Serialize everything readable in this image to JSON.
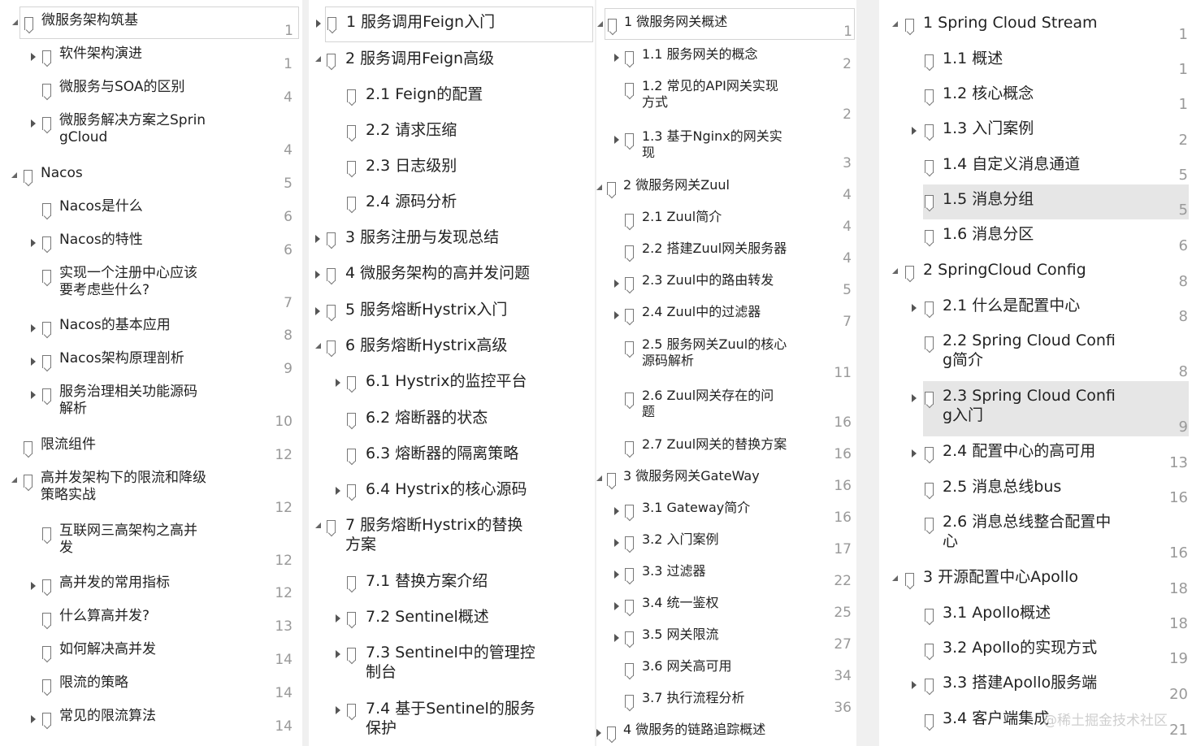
{
  "columns": [
    {
      "id": "col-0",
      "items": [
        {
          "label": "微服务架构筑基",
          "page": "1",
          "level": 0,
          "expander": "expanded",
          "boxed": true
        },
        {
          "label": "软件架构演进",
          "page": "1",
          "level": 1,
          "expander": "collapsed"
        },
        {
          "label": "微服务与SOA的区别",
          "page": "4",
          "level": 1,
          "expander": "none"
        },
        {
          "label": "微服务解决方案之Sprin\ngCloud",
          "page": "4",
          "level": 1,
          "expander": "collapsed"
        },
        {
          "label": "Nacos",
          "page": "5",
          "level": 0,
          "expander": "expanded"
        },
        {
          "label": "Nacos是什么",
          "page": "6",
          "level": 1,
          "expander": "none"
        },
        {
          "label": "Nacos的特性",
          "page": "6",
          "level": 1,
          "expander": "collapsed"
        },
        {
          "label": "实现一个注册中心应该\n要考虑些什么?",
          "page": "7",
          "level": 1,
          "expander": "none"
        },
        {
          "label": "Nacos的基本应用",
          "page": "8",
          "level": 1,
          "expander": "collapsed"
        },
        {
          "label": "Nacos架构原理剖析",
          "page": "9",
          "level": 1,
          "expander": "collapsed"
        },
        {
          "label": "服务治理相关功能源码\n解析",
          "page": "10",
          "level": 1,
          "expander": "collapsed"
        },
        {
          "label": "限流组件",
          "page": "12",
          "level": 0,
          "expander": "none"
        },
        {
          "label": "高并发架构下的限流和降级\n策略实战",
          "page": "12",
          "level": 0,
          "expander": "expanded"
        },
        {
          "label": "互联网三高架构之高并\n发",
          "page": "12",
          "level": 1,
          "expander": "none"
        },
        {
          "label": "高并发的常用指标",
          "page": "12",
          "level": 1,
          "expander": "collapsed"
        },
        {
          "label": "什么算高并发?",
          "page": "13",
          "level": 1,
          "expander": "none"
        },
        {
          "label": "如何解决高并发",
          "page": "14",
          "level": 1,
          "expander": "none"
        },
        {
          "label": "限流的策略",
          "page": "14",
          "level": 1,
          "expander": "none"
        },
        {
          "label": "常见的限流算法",
          "page": "14",
          "level": 1,
          "expander": "collapsed"
        }
      ]
    },
    {
      "id": "col-1",
      "items": [
        {
          "label": "1 服务调用Feign入门",
          "page": "",
          "level": 0,
          "expander": "collapsed",
          "boxed": true
        },
        {
          "label": "2 服务调用Feign高级",
          "page": "",
          "level": 0,
          "expander": "expanded"
        },
        {
          "label": "2.1 Feign的配置",
          "page": "",
          "level": 1,
          "expander": "none"
        },
        {
          "label": "2.2 请求压缩",
          "page": "",
          "level": 1,
          "expander": "none"
        },
        {
          "label": "2.3 日志级别",
          "page": "",
          "level": 1,
          "expander": "none"
        },
        {
          "label": "2.4 源码分析",
          "page": "",
          "level": 1,
          "expander": "none"
        },
        {
          "label": "3 服务注册与发现总结",
          "page": "",
          "level": 0,
          "expander": "collapsed"
        },
        {
          "label": "4 微服务架构的高并发问题",
          "page": "",
          "level": 0,
          "expander": "collapsed"
        },
        {
          "label": "5 服务熔断Hystrix入门",
          "page": "",
          "level": 0,
          "expander": "collapsed"
        },
        {
          "label": "6 服务熔断Hystrix高级",
          "page": "",
          "level": 0,
          "expander": "expanded"
        },
        {
          "label": "6.1 Hystrix的监控平台",
          "page": "",
          "level": 1,
          "expander": "collapsed"
        },
        {
          "label": "6.2 熔断器的状态",
          "page": "",
          "level": 1,
          "expander": "none"
        },
        {
          "label": "6.3 熔断器的隔离策略",
          "page": "",
          "level": 1,
          "expander": "none"
        },
        {
          "label": "6.4 Hystrix的核心源码",
          "page": "",
          "level": 1,
          "expander": "collapsed"
        },
        {
          "label": "7 服务熔断Hystrix的替换\n方案",
          "page": "",
          "level": 0,
          "expander": "expanded"
        },
        {
          "label": "7.1 替换方案介绍",
          "page": "",
          "level": 1,
          "expander": "none"
        },
        {
          "label": "7.2 Sentinel概述",
          "page": "",
          "level": 1,
          "expander": "collapsed"
        },
        {
          "label": "7.3 Sentinel中的管理控\n制台",
          "page": "",
          "level": 1,
          "expander": "collapsed"
        },
        {
          "label": "7.4 基于Sentinel的服务\n保护",
          "page": "",
          "level": 1,
          "expander": "collapsed"
        }
      ]
    },
    {
      "id": "col-2",
      "items": [
        {
          "label": "1 微服务网关概述",
          "page": "1",
          "level": 0,
          "expander": "expanded",
          "boxed": true
        },
        {
          "label": "1.1 服务网关的概念",
          "page": "2",
          "level": 1,
          "expander": "collapsed"
        },
        {
          "label": "1.2 常见的API网关实现\n方式",
          "page": "2",
          "level": 1,
          "expander": "none"
        },
        {
          "label": "1.3 基于Nginx的网关实\n现",
          "page": "3",
          "level": 1,
          "expander": "collapsed"
        },
        {
          "label": "2 微服务网关Zuul",
          "page": "4",
          "level": 0,
          "expander": "expanded"
        },
        {
          "label": "2.1 Zuul简介",
          "page": "4",
          "level": 1,
          "expander": "none"
        },
        {
          "label": "2.2 搭建Zuul网关服务器",
          "page": "4",
          "level": 1,
          "expander": "none"
        },
        {
          "label": "2.3 Zuul中的路由转发",
          "page": "5",
          "level": 1,
          "expander": "collapsed"
        },
        {
          "label": "2.4 Zuul中的过滤器",
          "page": "7",
          "level": 1,
          "expander": "collapsed"
        },
        {
          "label": "2.5 服务网关Zuul的核心\n源码解析",
          "page": "11",
          "level": 1,
          "expander": "none"
        },
        {
          "label": "2.6  Zuul网关存在的问\n题",
          "page": "16",
          "level": 1,
          "expander": "none"
        },
        {
          "label": "2.7 Zuul网关的替换方案",
          "page": "16",
          "level": 1,
          "expander": "none"
        },
        {
          "label": "3 微服务网关GateWay",
          "page": "16",
          "level": 0,
          "expander": "expanded"
        },
        {
          "label": "3.1 Gateway简介",
          "page": "16",
          "level": 1,
          "expander": "collapsed"
        },
        {
          "label": "3.2 入门案例",
          "page": "17",
          "level": 1,
          "expander": "collapsed"
        },
        {
          "label": "3.3 过滤器",
          "page": "22",
          "level": 1,
          "expander": "collapsed"
        },
        {
          "label": "3.4 统一鉴权",
          "page": "25",
          "level": 1,
          "expander": "collapsed"
        },
        {
          "label": "3.5 网关限流",
          "page": "27",
          "level": 1,
          "expander": "collapsed"
        },
        {
          "label": "3.6 网关高可用",
          "page": "34",
          "level": 1,
          "expander": "none"
        },
        {
          "label": "3.7 执行流程分析",
          "page": "36",
          "level": 1,
          "expander": "none"
        },
        {
          "label": "4 微服务的链路追踪概述",
          "page": "",
          "level": 0,
          "expander": "collapsed"
        }
      ]
    },
    {
      "id": "col-3",
      "items": [
        {
          "label": "1 Spring Cloud Stream",
          "page": "1",
          "level": 0,
          "expander": "expanded"
        },
        {
          "label": "1.1 概述",
          "page": "1",
          "level": 1,
          "expander": "none"
        },
        {
          "label": "1.2 核心概念",
          "page": "1",
          "level": 1,
          "expander": "none"
        },
        {
          "label": "1.3 入门案例",
          "page": "2",
          "level": 1,
          "expander": "collapsed"
        },
        {
          "label": "1.4 自定义消息通道",
          "page": "5",
          "level": 1,
          "expander": "none"
        },
        {
          "label": "1.5 消息分组",
          "page": "5",
          "level": 1,
          "expander": "none",
          "highlighted": true
        },
        {
          "label": "1.6 消息分区",
          "page": "6",
          "level": 1,
          "expander": "none"
        },
        {
          "label": "2 SpringCloud Config",
          "page": "8",
          "level": 0,
          "expander": "expanded"
        },
        {
          "label": "2.1 什么是配置中心",
          "page": "8",
          "level": 1,
          "expander": "collapsed"
        },
        {
          "label": "2.2 Spring Cloud Confi\ng简介",
          "page": "8",
          "level": 1,
          "expander": "none"
        },
        {
          "label": "2.3 Spring Cloud Confi\ng入门",
          "page": "9",
          "level": 1,
          "expander": "collapsed",
          "highlighted": true
        },
        {
          "label": "2.4 配置中心的高可用",
          "page": "13",
          "level": 1,
          "expander": "collapsed"
        },
        {
          "label": "2.5 消息总线bus",
          "page": "16",
          "level": 1,
          "expander": "none"
        },
        {
          "label": "2.6 消息总线整合配置中\n心",
          "page": "16",
          "level": 1,
          "expander": "none"
        },
        {
          "label": "3 开源配置中心Apollo",
          "page": "18",
          "level": 0,
          "expander": "expanded"
        },
        {
          "label": "3.1 Apollo概述",
          "page": "18",
          "level": 1,
          "expander": "none"
        },
        {
          "label": "3.2 Apollo的实现方式",
          "page": "19",
          "level": 1,
          "expander": "none"
        },
        {
          "label": "3.3 搭建Apollo服务端",
          "page": "20",
          "level": 1,
          "expander": "collapsed"
        },
        {
          "label": "3.4 客户端集成",
          "page": "21",
          "level": 1,
          "expander": "none"
        }
      ]
    }
  ],
  "watermark": "@稀土掘金技术社区"
}
